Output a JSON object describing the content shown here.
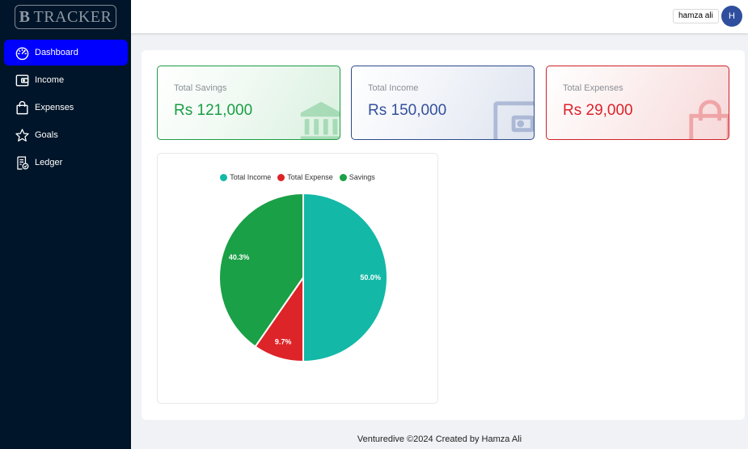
{
  "sidebar": {
    "logo": {
      "letter": "B",
      "text": "TRACKER"
    },
    "items": [
      {
        "label": "Dashboard",
        "icon": "dashboard-icon",
        "active": true
      },
      {
        "label": "Income",
        "icon": "wallet-icon",
        "active": false
      },
      {
        "label": "Expenses",
        "icon": "shopping-bag-icon",
        "active": false
      },
      {
        "label": "Goals",
        "icon": "star-icon",
        "active": false
      },
      {
        "label": "Ledger",
        "icon": "ledger-icon",
        "active": false
      }
    ]
  },
  "header": {
    "user_name": "hamza ali",
    "avatar_letter": "H"
  },
  "cards": {
    "savings": {
      "label": "Total Savings",
      "value": "Rs 121,000",
      "icon": "bank-icon",
      "color": "#1a9e44"
    },
    "income": {
      "label": "Total Income",
      "value": "Rs 150,000",
      "icon": "wallet-icon",
      "color": "#34509a"
    },
    "expenses": {
      "label": "Total Expenses",
      "value": "Rs 29,000",
      "icon": "shopping-bag-icon",
      "color": "#db2329"
    }
  },
  "chart_data": {
    "type": "pie",
    "categories": [
      "Total Income",
      "Total Expense",
      "Savings"
    ],
    "values": [
      150000,
      29000,
      121000
    ],
    "percent_labels": [
      "50.0%",
      "9.7%",
      "40.3%"
    ],
    "colors": [
      "#13b8a6",
      "#dd2428",
      "#1aa046"
    ],
    "legend_position": "top"
  },
  "footer": {
    "text": "Venturedive ©2024 Created by Hamza Ali"
  }
}
